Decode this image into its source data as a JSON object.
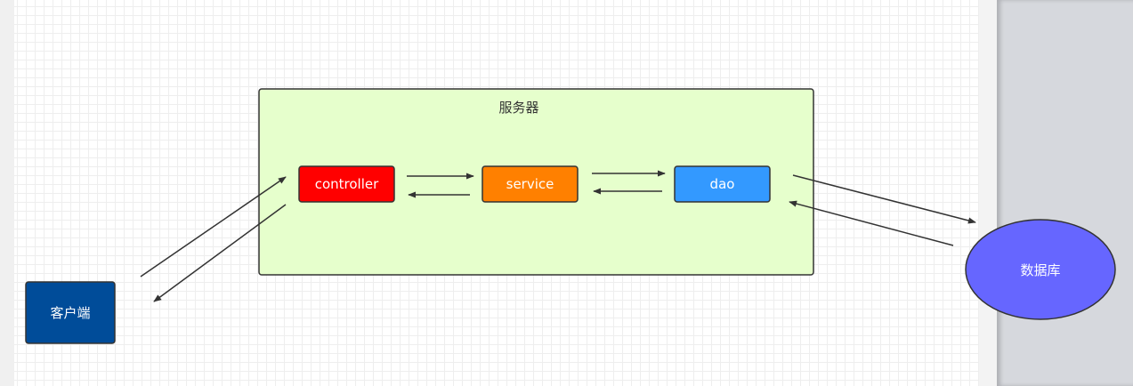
{
  "server_group": {
    "label": "服务器",
    "fill": "#e6ffcc"
  },
  "nodes": {
    "controller": {
      "label": "controller",
      "fill": "#ff0000",
      "text_color": "#ffffff"
    },
    "service": {
      "label": "service",
      "fill": "#ff8000",
      "text_color": "#ffffff"
    },
    "dao": {
      "label": "dao",
      "fill": "#3399ff",
      "text_color": "#ffffff"
    },
    "client": {
      "label": "客户端",
      "fill": "#004c99",
      "text_color": "#ffffff"
    },
    "database": {
      "label": "数据库",
      "fill": "#6666ff",
      "text_color": "#ffffff"
    }
  },
  "edges": [
    {
      "from": "client",
      "to": "controller"
    },
    {
      "from": "controller",
      "to": "client"
    },
    {
      "from": "controller",
      "to": "service"
    },
    {
      "from": "service",
      "to": "controller"
    },
    {
      "from": "service",
      "to": "dao"
    },
    {
      "from": "dao",
      "to": "service"
    },
    {
      "from": "dao",
      "to": "database"
    },
    {
      "from": "database",
      "to": "dao"
    }
  ]
}
